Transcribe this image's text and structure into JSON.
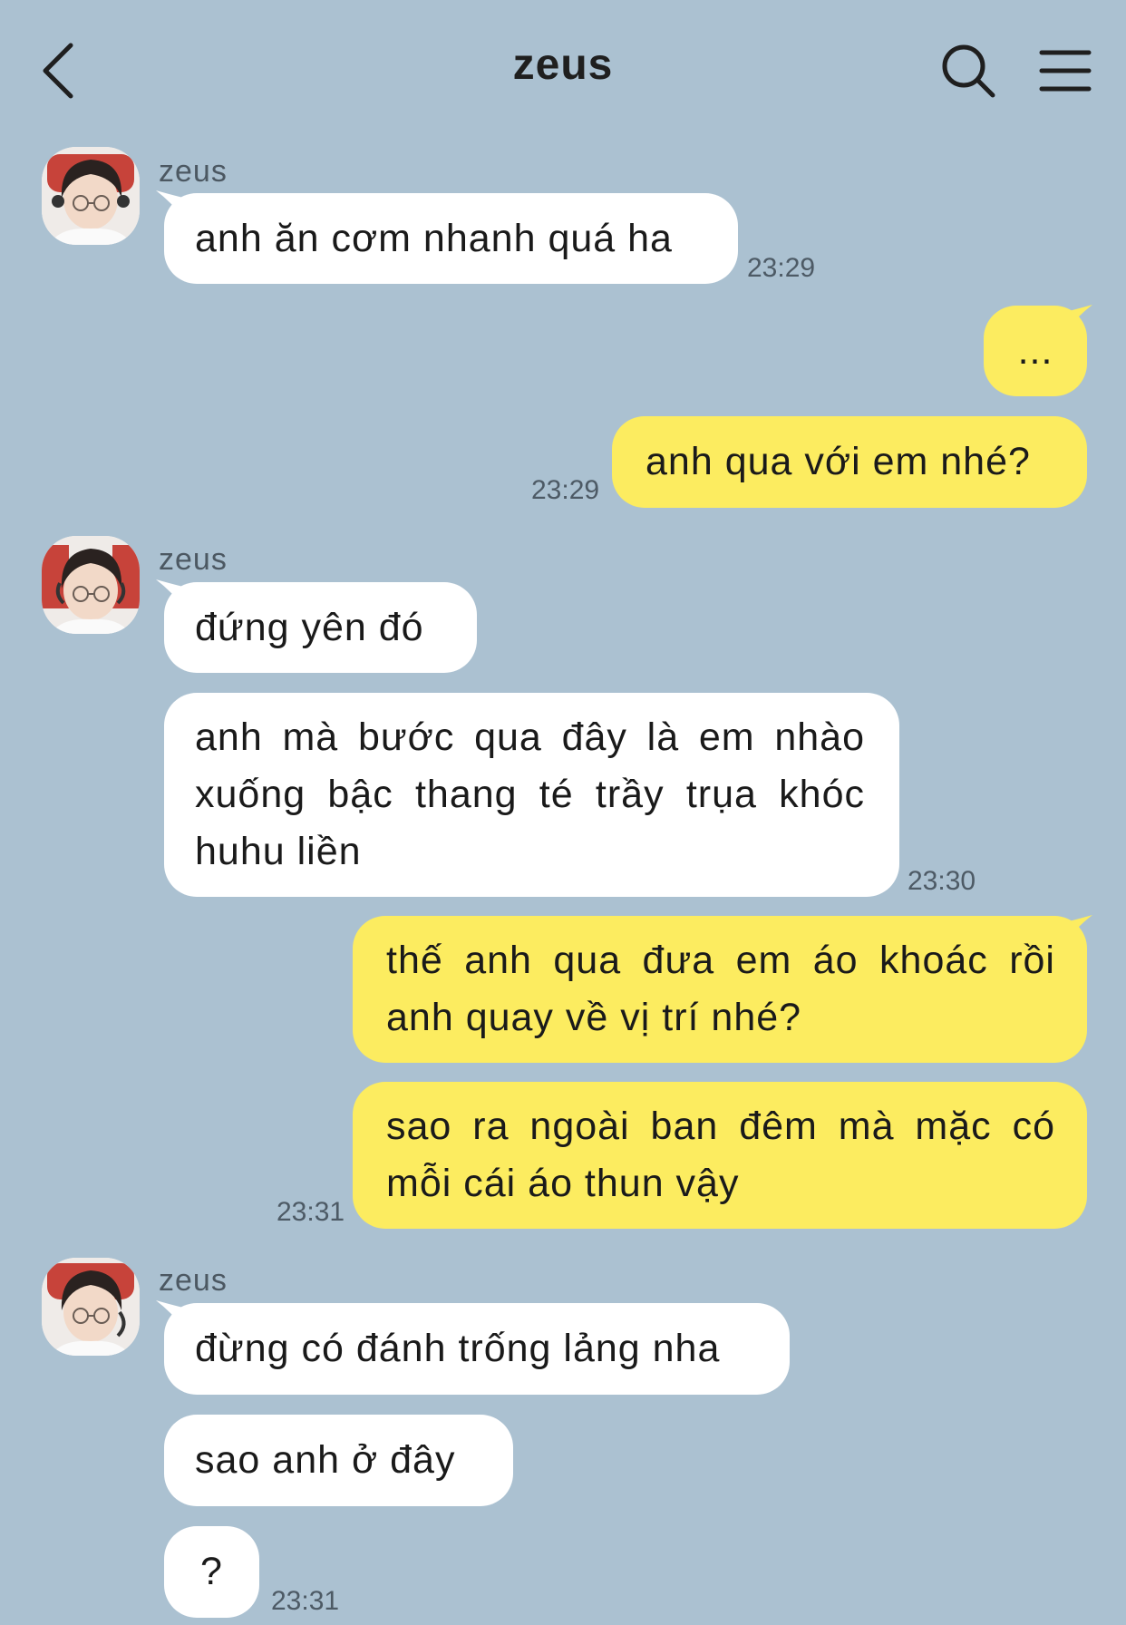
{
  "header": {
    "title": "zeus",
    "back_icon": "chevron-left-icon",
    "search_icon": "search-icon",
    "menu_icon": "hamburger-menu-icon"
  },
  "colors": {
    "background": "#abc1d1",
    "incoming_bubble": "#ffffff",
    "outgoing_bubble": "#fcec60"
  },
  "messages": [
    {
      "group": 1,
      "sender": "zeus",
      "text": "anh ăn cơm nhanh quá ha",
      "time": "23:29"
    },
    {
      "text": "..."
    },
    {
      "text": "anh qua với em nhé?",
      "time": "23:29"
    },
    {
      "group": 2,
      "sender": "zeus",
      "text": "đứng yên đó"
    },
    {
      "text": "anh mà bước qua đây là em nhào xuống bậc thang té trầy trụa khóc huhu liền",
      "time": "23:30"
    },
    {
      "text": "thế anh qua đưa em áo khoác rồi anh quay về vị trí nhé?"
    },
    {
      "text": "sao ra ngoài ban đêm mà mặc có mỗi cái áo thun vậy",
      "time": "23:31"
    },
    {
      "group": 3,
      "sender": "zeus",
      "text": "đừng có đánh trống lảng nha"
    },
    {
      "text": "sao anh ở đây"
    },
    {
      "text": "?",
      "time": "23:31"
    }
  ]
}
